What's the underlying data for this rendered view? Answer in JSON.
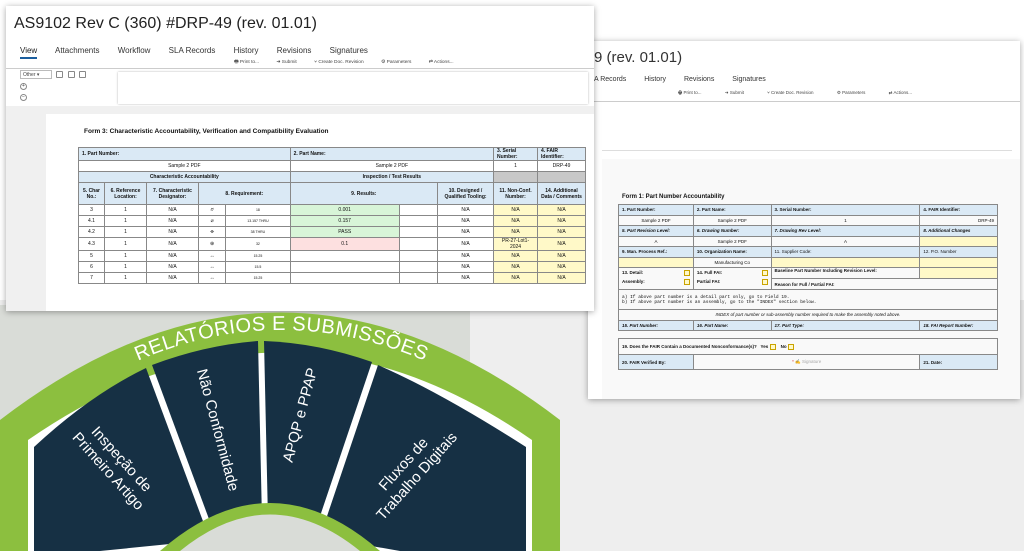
{
  "colors": {
    "accent": "#8cbf3f",
    "dark": "#163044",
    "tab_underline": "#1b5e9e",
    "header_blue": "#dae9f5",
    "field_yellow": "#fff9c8",
    "pass_green": "#d8f5d8",
    "fail_red": "#fde0e0"
  },
  "front": {
    "title": "AS9102 Rev C (360) #DRP-49 (rev. 01.01)",
    "tabs": [
      "View",
      "Attachments",
      "Workflow",
      "SLA Records",
      "History",
      "Revisions",
      "Signatures"
    ],
    "toolbar": [
      "Print to...",
      "Submit",
      "Create Doc. Revision",
      "Parameters",
      "Actions..."
    ],
    "toolbar_icons": [
      "printer-icon",
      "arrow-right-icon",
      "branch-icon",
      "gear-icon",
      "transfer-icon"
    ],
    "filter_select": "Other",
    "form_title": "Form 3: Characteristic Accountability, Verification and Compatibility Evaluation",
    "part_number_label": "1. Part Number:",
    "part_name_label": "2. Part Name:",
    "serial_label": "3. Serial Number:",
    "fair_label": "4. FAIR Identifier:",
    "part_number": "Sample 2 PDF",
    "part_name": "Sample 2 PDF",
    "serial": "1",
    "fair": "DRP-49",
    "section_left": "Characteristic Accountability",
    "section_right": "Inspection / Test Results",
    "columns": [
      "5. Char No.:",
      "6. Reference Location:",
      "7. Characteristic Designator:",
      "8. Requirement:",
      "9. Results:",
      "10. Designed / Qualified Tooling:",
      "11. Non-Conf. Number:",
      "14. Additional Data / Comments"
    ],
    "rows": [
      {
        "no": "3",
        "ref": "1",
        "des": "N/A",
        "sym": "⌭",
        "req": "18",
        "res": "0.001",
        "res_status": "pass",
        "tool": "N/A",
        "nc": "N/A",
        "comment": "N/A"
      },
      {
        "no": "4.1",
        "ref": "1",
        "des": "N/A",
        "sym": "⌀",
        "req": "13.157 THRU",
        "res": "0.157",
        "res_status": "pass",
        "tool": "N/A",
        "nc": "N/A",
        "comment": "N/A"
      },
      {
        "no": "4.2",
        "ref": "1",
        "des": "N/A",
        "sym": "⌯",
        "req": "38 THRU",
        "res": "PASS",
        "res_status": "pass",
        "tool": "N/A",
        "nc": "N/A",
        "comment": "N/A"
      },
      {
        "no": "4.3",
        "ref": "1",
        "des": "N/A",
        "sym": "⊕",
        "req": "32",
        "res": "0.1",
        "res_status": "fail",
        "tool": "N/A",
        "nc": "PR-27-Lot1-2024",
        "comment": "N/A"
      },
      {
        "no": "5",
        "ref": "1",
        "des": "N/A",
        "sym": "↔",
        "req": "15.25",
        "res": "",
        "res_status": "none",
        "tool": "N/A",
        "nc": "N/A",
        "comment": "N/A"
      },
      {
        "no": "6",
        "ref": "1",
        "des": "N/A",
        "sym": "↔",
        "req": "15.5",
        "res": "",
        "res_status": "none",
        "tool": "N/A",
        "nc": "N/A",
        "comment": "N/A"
      },
      {
        "no": "7",
        "ref": "1",
        "des": "N/A",
        "sym": "↔",
        "req": "15.25",
        "res": "",
        "res_status": "none",
        "tool": "N/A",
        "nc": "N/A",
        "comment": "N/A"
      }
    ]
  },
  "back": {
    "title": "9 (rev. 01.01)",
    "tabs": [
      "A Records",
      "History",
      "Revisions",
      "Signatures"
    ],
    "toolbar": [
      "Print to...",
      "Submit",
      "Create Doc. Revision",
      "Parameters",
      "Actions..."
    ],
    "form_title": "Form 1: Part Number Accountability",
    "r1_labels": [
      "1. Part Number:",
      "2. Part Name:",
      "3. Serial Number:",
      "4. FAIR Identifier:"
    ],
    "r1_values": [
      "Sample 2 PDF",
      "Sample 2 PDF",
      "1",
      "DRP-49"
    ],
    "r2_labels": [
      "5. Part Revision Level:",
      "6. Drawing Number:",
      "7. Drawing Rev Level:",
      "8. Additional Changes"
    ],
    "r2_values": [
      "A",
      "Sample 2 PDF",
      "A",
      ""
    ],
    "r3_labels": [
      "9. Man. Process Ref.:",
      "10. Organization Name:",
      "11. Supplier Code:",
      "12. P.O. Number"
    ],
    "r3_values": [
      "",
      "Manufacturing Co",
      "",
      ""
    ],
    "detail_label": "13. Detail:",
    "assembly_label": "Assembly:",
    "full_fai_label": "14. Full FAI:",
    "partial_fai_label": "Partial FAI:",
    "baseline_label": "Baseline Part Number Including Revision Level:",
    "reason_label": "Reason for Full / Partial FAI:",
    "note_a": "a) If above part number is a detail part only, go to Field 19.",
    "note_b": "b) If above part number is an assembly, go to the \"INDEX\" section below.",
    "index_note": "INDEX of part number or sub-assembly number required to make the assembly noted above.",
    "r4_labels": [
      "15. Part Number:",
      "16. Part Name:",
      "17. Part Type:",
      "18. FAI Report Number:"
    ],
    "q19": "19. Does the FAIR Contain a Documented Nonconformance(s)?",
    "yes": "Yes",
    "no": "No",
    "verified_label": "20. FAIR Verified By:",
    "signature_placeholder": "Signature",
    "date_label": "21. Date:"
  },
  "fan": {
    "arc_title": "RELATÓRIOS E SUBMISSÕES",
    "segments": [
      "Inspeção de Primeiro Artigo",
      "Não Conformidade",
      "APQP e PPAP",
      "Fluxos de Trabalho Digitais"
    ]
  }
}
